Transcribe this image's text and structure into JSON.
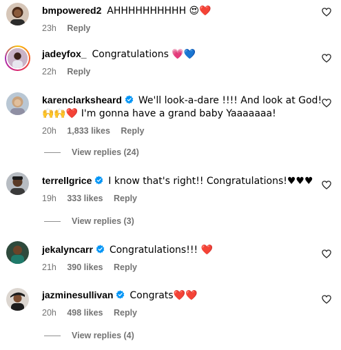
{
  "comments": [
    {
      "username": "bmpowered2",
      "verified": false,
      "text": "AHHHHHHHHHH 😍❤️",
      "time": "23h",
      "likes": "",
      "reply": "Reply",
      "avatar_icon": "profile-photo"
    },
    {
      "username": "jadeyfox_",
      "verified": false,
      "text": "Congratulations 💗💙",
      "time": "22h",
      "likes": "",
      "reply": "Reply",
      "avatar_icon": "profile-photo-with-story-ring"
    },
    {
      "username": "karenclarksheard",
      "verified": true,
      "text": "We'll look-a-dare !!!! And look at God!",
      "text2": "🙌🙌❤️ I'm gonna have a grand baby Yaaaaaaa!",
      "time": "20h",
      "likes": "1,833 likes",
      "reply": "Reply",
      "view_replies": "View replies (24)",
      "avatar_icon": "profile-photo"
    },
    {
      "username": "terrellgrice",
      "verified": true,
      "text": "I know that's right!! Congratulations!♥♥♥",
      "time": "19h",
      "likes": "333 likes",
      "reply": "Reply",
      "view_replies": "View replies (3)",
      "avatar_icon": "profile-photo"
    },
    {
      "username": "jekalyncarr",
      "verified": true,
      "text": "Congratulations!!! ❤️",
      "time": "21h",
      "likes": "390 likes",
      "reply": "Reply",
      "avatar_icon": "profile-photo"
    },
    {
      "username": "jazminesullivan",
      "verified": true,
      "text": "Congrats❤️❤️",
      "time": "20h",
      "likes": "498 likes",
      "reply": "Reply",
      "view_replies": "View replies (4)",
      "avatar_icon": "profile-photo"
    }
  ],
  "colors": {
    "verified_badge": "#0095f6",
    "meta_text": "#737373",
    "story_ring": "#d8226d"
  },
  "icons": {
    "like": "heart-outline-icon",
    "verified": "verified-badge-icon"
  }
}
